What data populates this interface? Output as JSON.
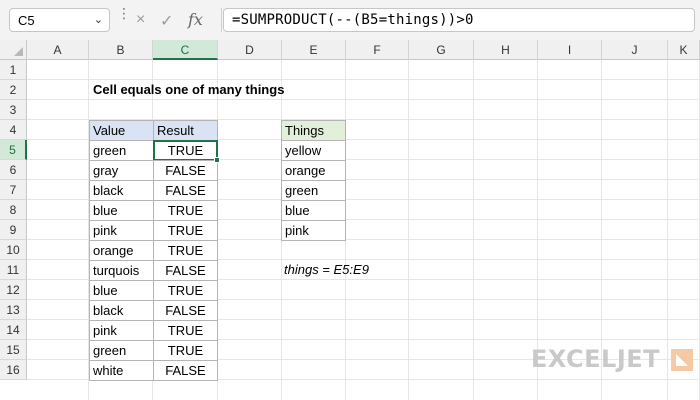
{
  "formula_bar": {
    "name_box": "C5",
    "cancel_icon": "×",
    "enter_icon": "✓",
    "fx_label": "fx",
    "formula": "=SUMPRODUCT(--(B5=things))>0"
  },
  "columns": [
    "A",
    "B",
    "C",
    "D",
    "E",
    "F",
    "G",
    "H",
    "I",
    "J",
    "K"
  ],
  "rows": [
    "1",
    "2",
    "3",
    "4",
    "5",
    "6",
    "7",
    "8",
    "9",
    "10",
    "11",
    "12",
    "13",
    "14",
    "15",
    "16"
  ],
  "active": {
    "column": "C",
    "row": "5"
  },
  "title": "Cell equals one of many things",
  "main_table": {
    "headers": [
      "Value",
      "Result"
    ],
    "rows": [
      [
        "green",
        "TRUE"
      ],
      [
        "gray",
        "FALSE"
      ],
      [
        "black",
        "FALSE"
      ],
      [
        "blue",
        "TRUE"
      ],
      [
        "pink",
        "TRUE"
      ],
      [
        "orange",
        "TRUE"
      ],
      [
        "turquois",
        "FALSE"
      ],
      [
        "blue",
        "TRUE"
      ],
      [
        "black",
        "FALSE"
      ],
      [
        "pink",
        "TRUE"
      ],
      [
        "green",
        "TRUE"
      ],
      [
        "white",
        "FALSE"
      ]
    ]
  },
  "things_table": {
    "header": "Things",
    "items": [
      "yellow",
      "orange",
      "green",
      "blue",
      "pink"
    ]
  },
  "named_range_note": "things = E5:E9",
  "logo": {
    "text": "EXCELJET"
  },
  "colors": {
    "accent": "#217346",
    "header_blue": "#dae3f3",
    "header_green": "#e2efda"
  }
}
